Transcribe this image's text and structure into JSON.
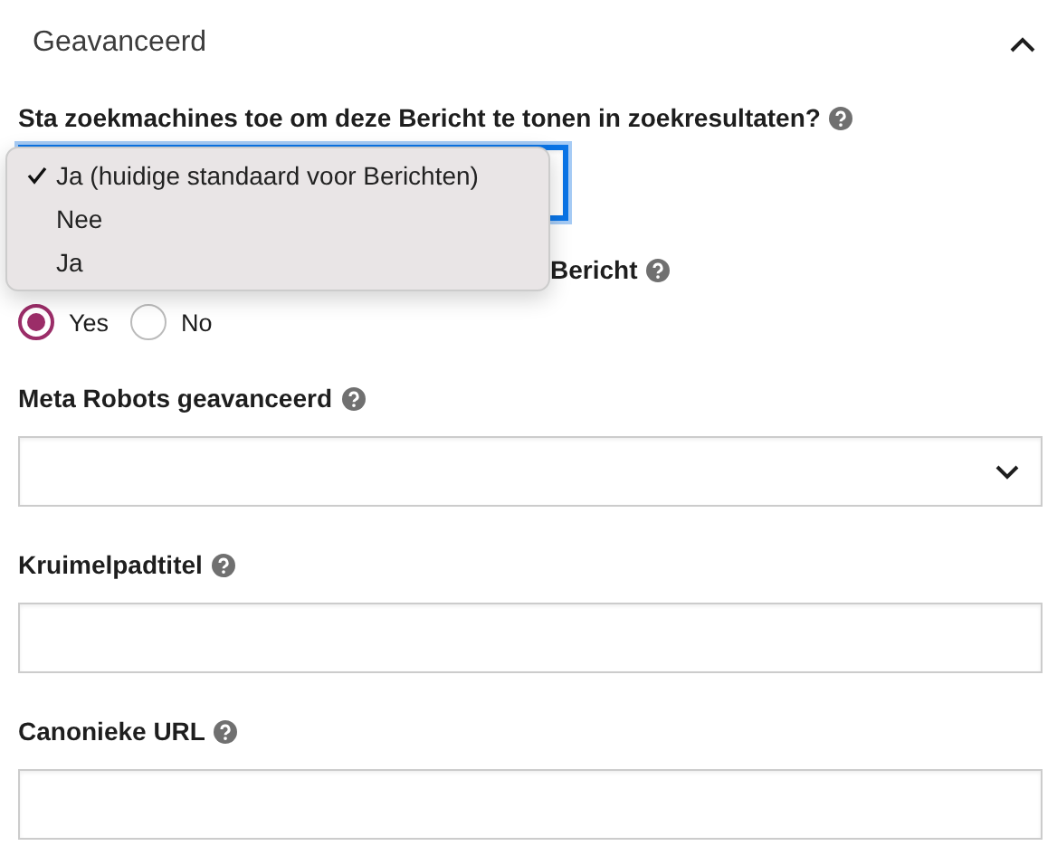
{
  "section": {
    "title": "Geavanceerd",
    "expanded": true
  },
  "fields": [
    {
      "kind": "select",
      "label": "Sta zoekmachines toe om deze Bericht te tonen in zoekresultaten?",
      "focused": true,
      "menu": [
        {
          "label": "Ja (huidige standaard voor Berichten)",
          "selected": true
        },
        {
          "label": "Nee",
          "selected": false
        },
        {
          "label": "Ja",
          "selected": false
        }
      ]
    },
    {
      "kind": "radio",
      "label": "Bericht",
      "label_covered": true,
      "options": [
        {
          "label": "Yes",
          "selected": true
        },
        {
          "label": "No",
          "selected": false
        }
      ]
    },
    {
      "kind": "select",
      "label": "Meta Robots geavanceerd",
      "focused": false
    },
    {
      "kind": "text",
      "label": "Kruimelpadtitel"
    },
    {
      "kind": "text",
      "label": "Canonieke URL"
    }
  ]
}
